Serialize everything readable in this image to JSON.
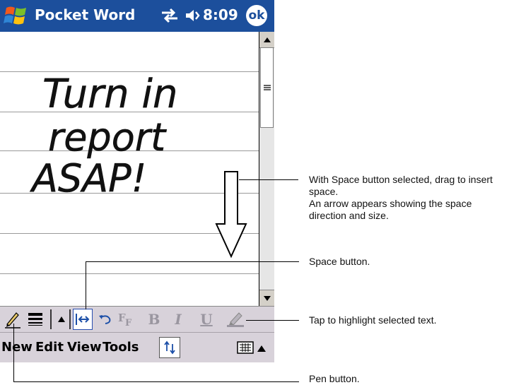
{
  "app_title": "Pocket Word",
  "clock": "8:09",
  "ok_label": "ok",
  "handwriting": [
    "Turn in",
    "report",
    "ASAP!"
  ],
  "menu": {
    "new": "New",
    "edit": "Edit",
    "view": "View",
    "tools": "Tools"
  },
  "toolbar_labels": {
    "bold": "B",
    "italic": "I",
    "underline": "U"
  },
  "callouts": {
    "space_drag_line1": "With Space button selected, drag to insert",
    "space_drag_line2": "space.",
    "space_drag_line3": "An arrow appears showing the space",
    "space_drag_line4": "direction and size.",
    "space_button": "Space button.",
    "highlight": "Tap to highlight selected text.",
    "pen_button": "Pen button."
  },
  "icons": [
    "windows-flag-icon",
    "connectivity-icon",
    "volume-icon",
    "pen-icon",
    "line-width-icon",
    "space-icon",
    "undo-icon",
    "font-icon",
    "highlighter-icon",
    "keyboard-icon",
    "arrow-down-icon"
  ],
  "colors": {
    "titlebar": "#1c4f9c",
    "toolbar": "#d8d2da",
    "ruled_line": "#9a9a9a"
  }
}
